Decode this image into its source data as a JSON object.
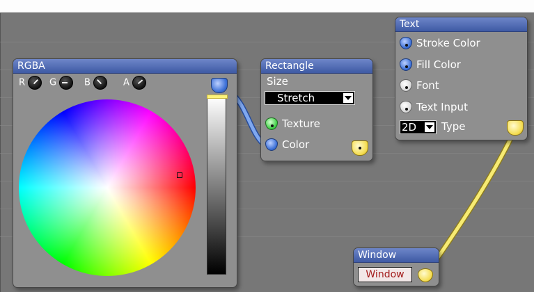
{
  "nodes": {
    "rgba": {
      "title": "RGBA",
      "knobs": [
        {
          "label": "R"
        },
        {
          "label": "G"
        },
        {
          "label": "B"
        },
        {
          "label": "A"
        }
      ]
    },
    "rectangle": {
      "title": "Rectangle",
      "size_label": "Size",
      "size_value": "Stretch",
      "texture_label": "Texture",
      "color_label": "Color"
    },
    "text": {
      "title": "Text",
      "stroke_color_label": "Stroke Color",
      "fill_color_label": "Fill Color",
      "font_label": "Font",
      "text_input_label": "Text Input",
      "type_value": "2D",
      "type_label": "Type"
    },
    "window": {
      "title": "Window",
      "button_label": "Window"
    }
  },
  "colors": {
    "title_bar": "#4a66b0",
    "node_body": "#8f8f8f",
    "wire_yellow": "#f4e86a",
    "wire_blue": "#6f9ee8",
    "canvas": "#777777"
  }
}
